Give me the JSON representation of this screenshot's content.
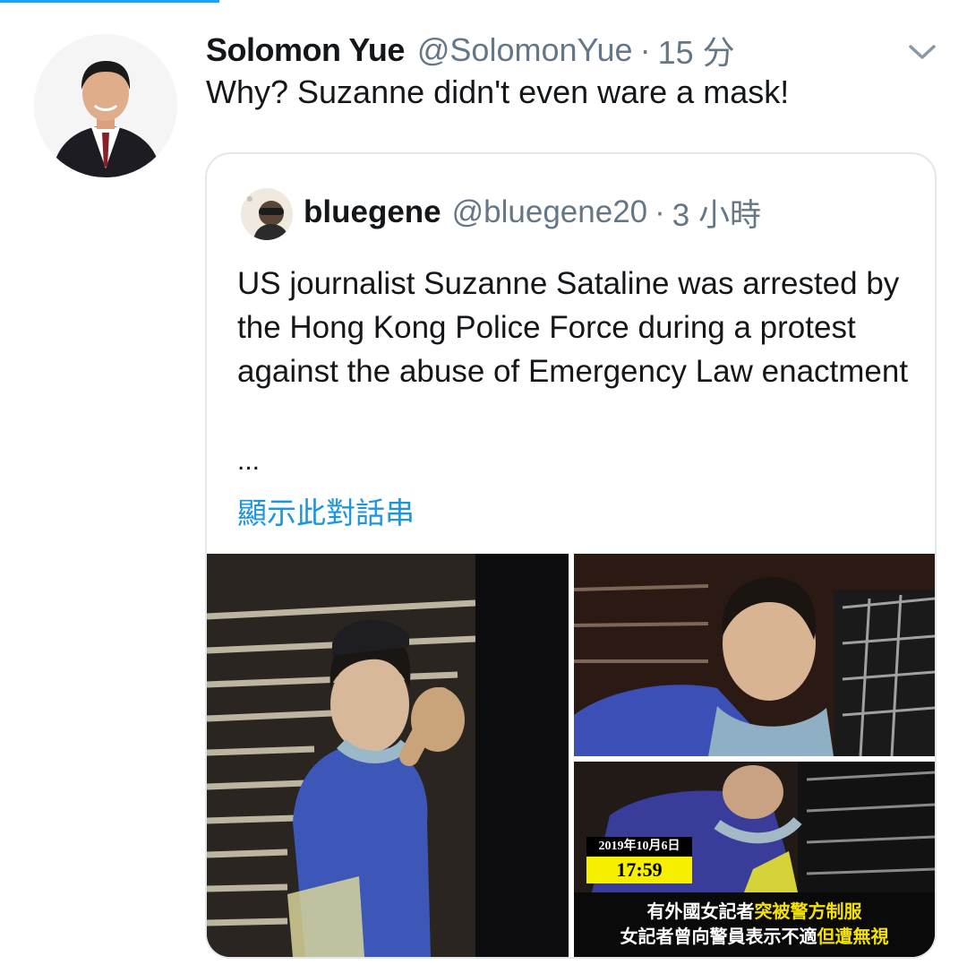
{
  "tweet": {
    "author_name": "Solomon Yue",
    "author_handle": "@SolomonYue",
    "separator": "·",
    "time": "15 分",
    "text": "Why? Suzanne didn't even ware a mask!",
    "avatar_icon": "profile-photo",
    "menu_icon": "chevron-down-icon"
  },
  "quoted": {
    "author_name": "bluegene",
    "author_handle": "@bluegene20",
    "separator": "·",
    "time": "3 小時",
    "text": "US journalist Suzanne Sataline was arrested by the Hong Kong Police Force during a protest against the abuse of Emergency Law enactment",
    "ellipsis": "...",
    "show_thread": "顯示此對話串"
  },
  "media": {
    "photo3": {
      "date_stamp": "2019年10月6日",
      "clock": "17:59",
      "subtitle_line1_a": "有外國女記者",
      "subtitle_line1_b": "突被警方制服",
      "subtitle_line2_a": "女記者曾向警員表示不適",
      "subtitle_line2_b": "但遭無視"
    }
  },
  "colors": {
    "link": "#1b95e0",
    "secondary_text": "#657786",
    "border": "#e1e8ed",
    "accent": "#1da1f2"
  }
}
